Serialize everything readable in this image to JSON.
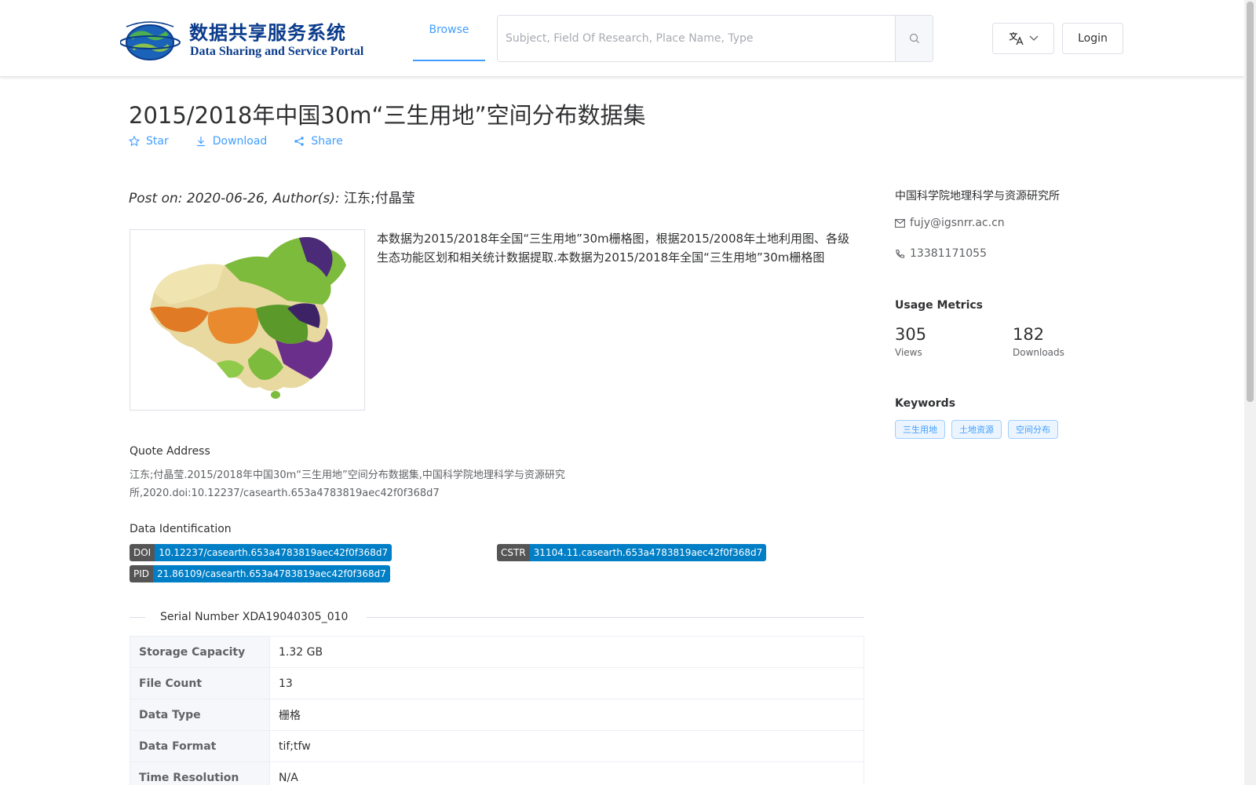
{
  "header": {
    "logo_cn": "数据共享服务系统",
    "logo_en": "Data Sharing and Service Portal",
    "nav_browse": "Browse",
    "search_placeholder": "Subject, Field Of Research, Place Name, Type",
    "login": "Login",
    "lang_icon": "translate-icon"
  },
  "dataset": {
    "title": "2015/2018年中国30m“三生用地”空间分布数据集",
    "actions": {
      "star": "Star",
      "download": "Download",
      "share": "Share"
    },
    "post_prefix": "Post on: 2020-06-26, Author(s): ",
    "authors": "江东;付晶莹",
    "description": "本数据为2015/2018年全国“三生用地”30m栅格图，根据2015/2008年土地利用图、各级生态功能区划和相关统计数据提取.本数据为2015/2018年全国“三生用地”30m栅格图",
    "quote_label": "Quote Address",
    "quote_text": "江东;付晶莹.2015/2018年中国30m“三生用地”空间分布数据集,中国科学院地理科学与资源研究所,2020.doi:10.12237/casearth.653a4783819aec42f0f368d7",
    "ident_label": "Data Identification",
    "identifiers": {
      "doi_key": "DOI",
      "doi_val": "10.12237/casearth.653a4783819aec42f0f368d7",
      "cstr_key": "CSTR",
      "cstr_val": "31104.11.casearth.653a4783819aec42f0f368d7",
      "pid_key": "PID",
      "pid_val": "21.86109/casearth.653a4783819aec42f0f368d7"
    },
    "serial": "Serial Number XDA19040305_010",
    "table": [
      {
        "label": "Storage Capacity",
        "value": "1.32 GB"
      },
      {
        "label": "File Count",
        "value": "13"
      },
      {
        "label": "Data Type",
        "value": "栅格"
      },
      {
        "label": "Data Format",
        "value": "tif;tfw"
      },
      {
        "label": "Time Resolution",
        "value": "N/A"
      }
    ]
  },
  "sidebar": {
    "org": "中国科学院地理科学与资源研究所",
    "email": "fujy@igsnrr.ac.cn",
    "phone": "13381171055",
    "metrics_title": "Usage Metrics",
    "views": "305",
    "views_label": "Views",
    "downloads": "182",
    "downloads_label": "Downloads",
    "keywords_title": "Keywords",
    "keywords": [
      "三生用地",
      "土地资源",
      "空间分布"
    ]
  },
  "colors": {
    "accent": "#409eff",
    "badge_key": "#555555",
    "badge_value": "#007ec6"
  }
}
